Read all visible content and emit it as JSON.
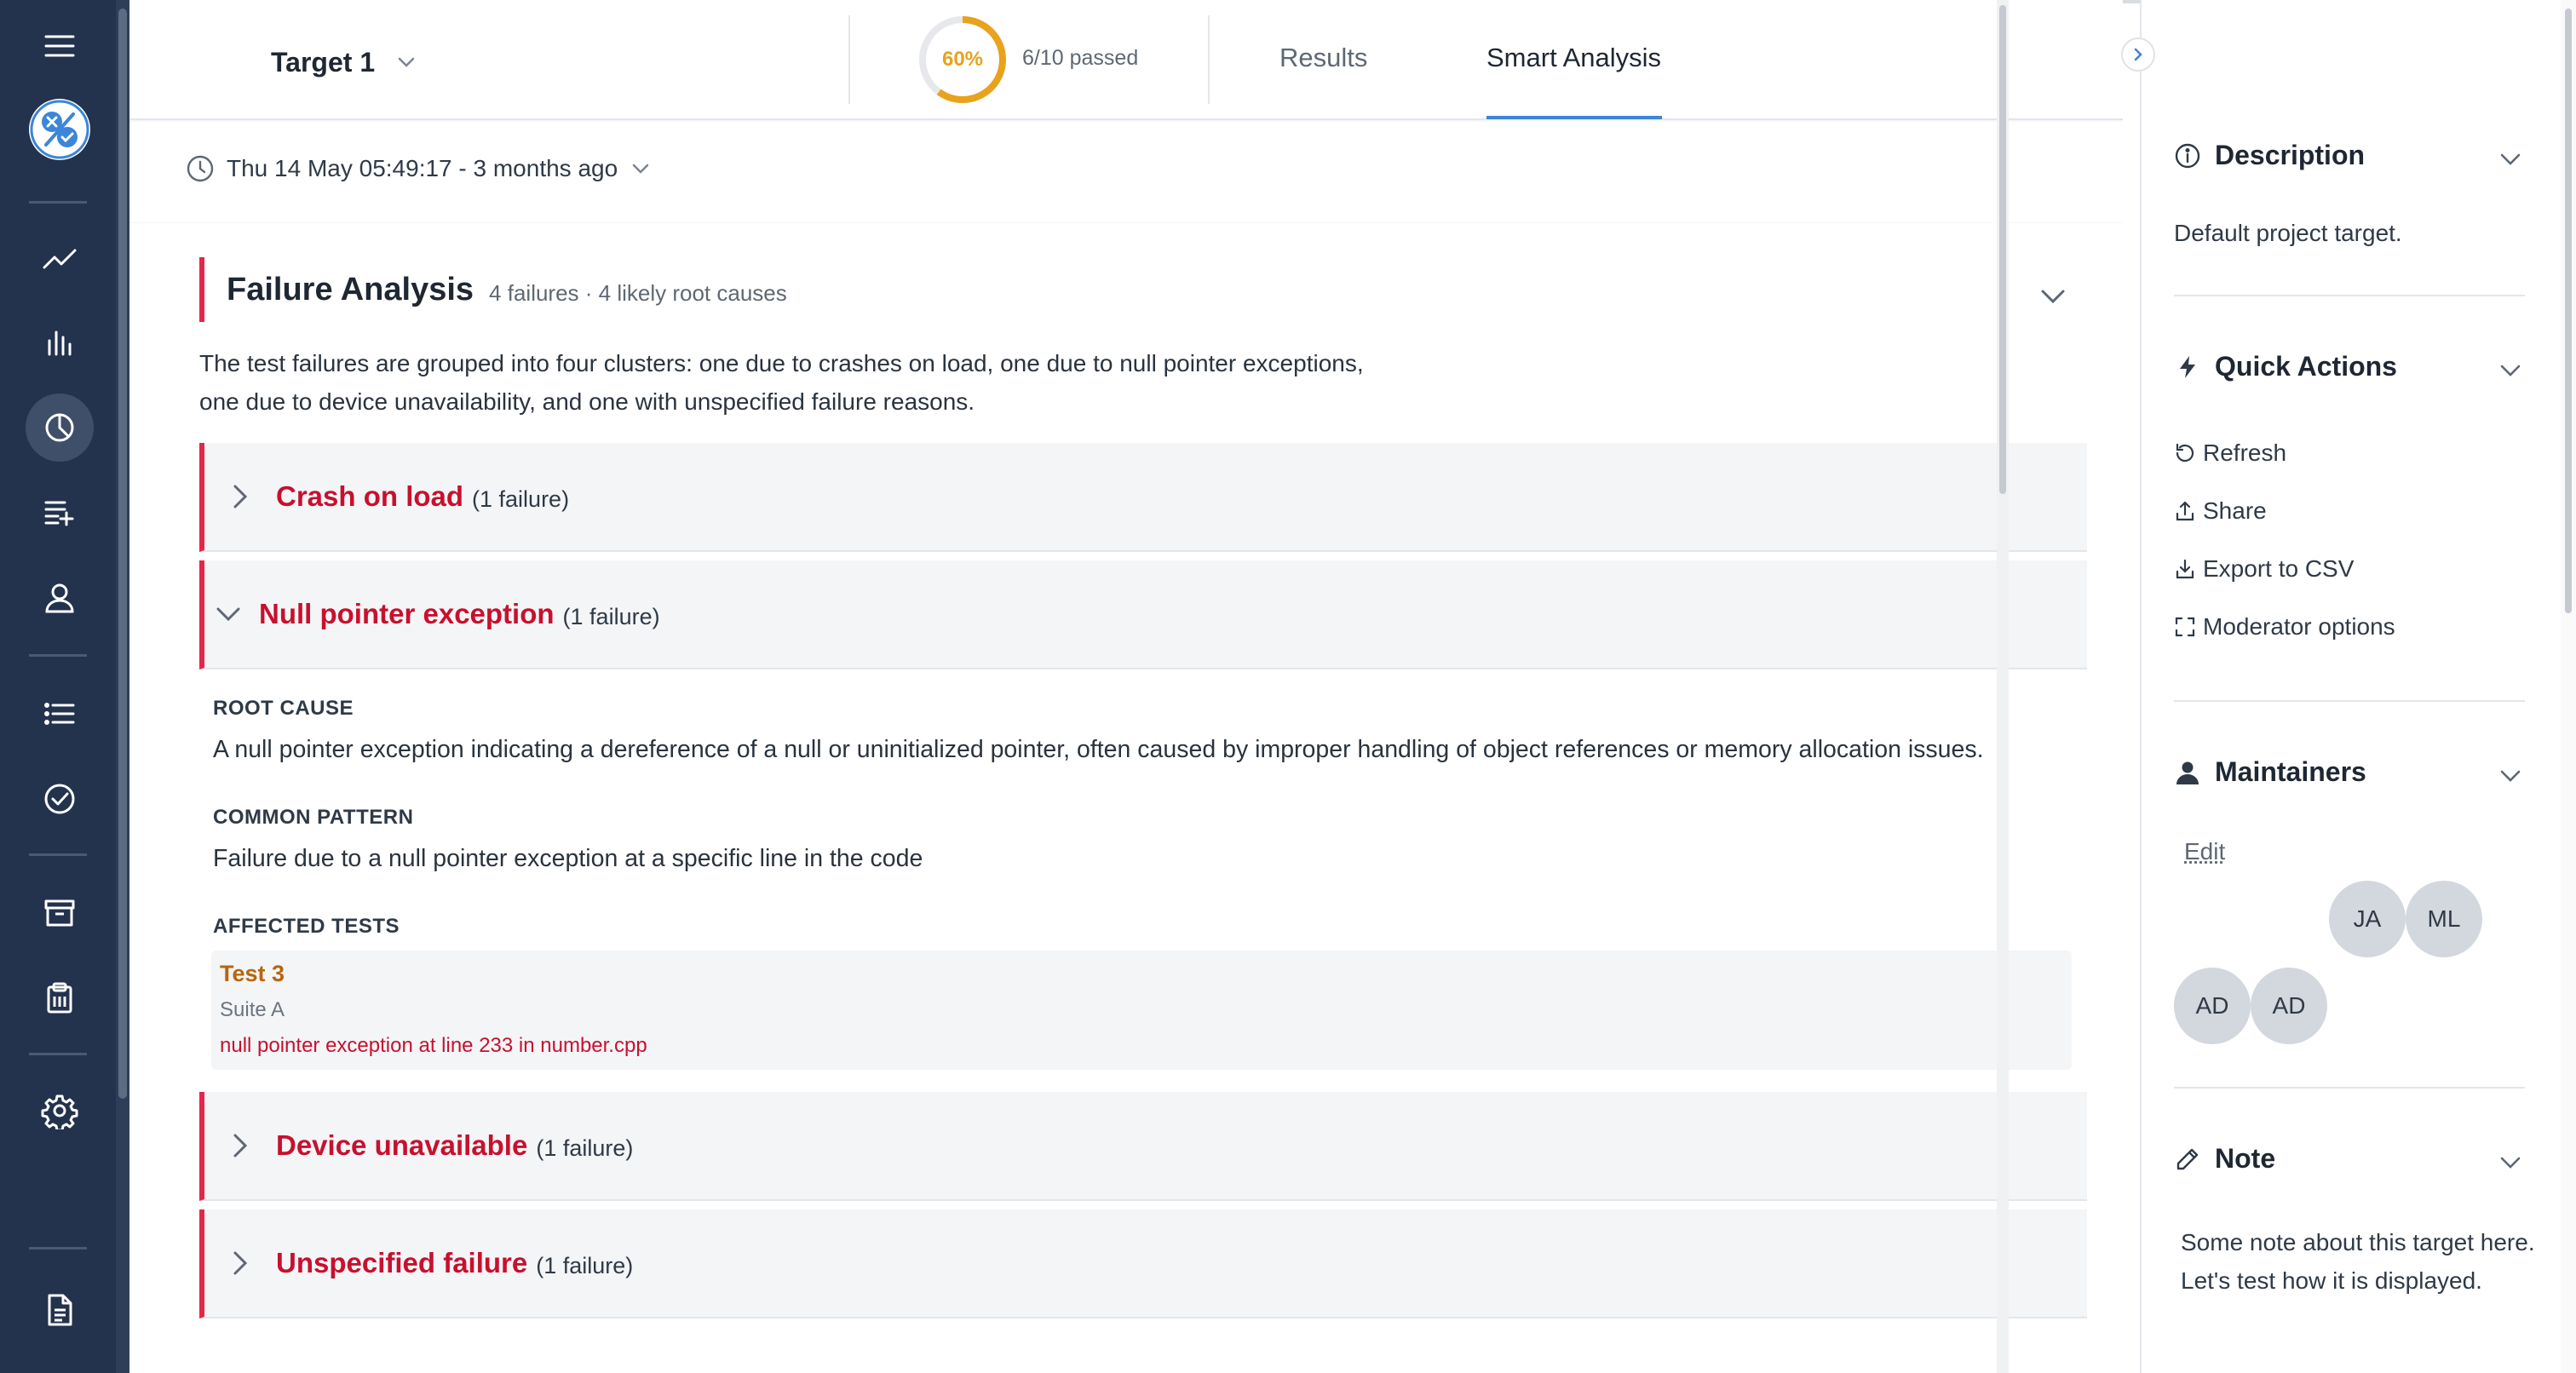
{
  "header": {
    "target_label": "Target 1",
    "progress": {
      "percent_label": "60%",
      "fraction": 0.6,
      "passed_label": "6/10 passed",
      "color": "#e8a21c"
    },
    "tabs": [
      {
        "label": "Results",
        "active": false
      },
      {
        "label": "Smart Analysis",
        "active": true
      }
    ],
    "accent": "#3b86d8"
  },
  "datebar": {
    "label": "Thu 14 May 05:49:17 - 3 months ago"
  },
  "failure_analysis": {
    "title": "Failure Analysis",
    "subtitle": "4 failures · 4 likely root causes",
    "description": "The test failures are grouped into four clusters: one due to crashes on load, one due to null pointer exceptions, one due to device unavailability, and one with unspecified failure reasons.",
    "clusters": [
      {
        "name": "Crash on load",
        "count": "(1 failure)",
        "expanded": false
      },
      {
        "name": "Null pointer exception",
        "count": "(1 failure)",
        "expanded": true
      },
      {
        "name": "Device unavailable",
        "count": "(1 failure)",
        "expanded": false
      },
      {
        "name": "Unspecified failure",
        "count": "(1 failure)",
        "expanded": false
      }
    ],
    "expanded_detail": {
      "root_cause_label": "ROOT CAUSE",
      "root_cause": "A null pointer exception indicating a dereference of a null or uninitialized pointer, often caused by improper handling of object references or memory allocation issues.",
      "pattern_label": "COMMON PATTERN",
      "pattern": "Failure due to a null pointer exception at a specific line in the code",
      "affected_label": "AFFECTED TESTS",
      "test": {
        "name": "Test 3",
        "suite": "Suite A",
        "error": "null pointer exception at line 233 in number.cpp"
      }
    },
    "error_color": "#c8102e"
  },
  "right_panel": {
    "description": {
      "title": "Description",
      "text": "Default project target."
    },
    "quick_actions": {
      "title": "Quick Actions",
      "items": [
        {
          "label": "Refresh",
          "icon": "refresh-icon"
        },
        {
          "label": "Share",
          "icon": "share-icon"
        },
        {
          "label": "Export to CSV",
          "icon": "download-icon"
        },
        {
          "label": "Moderator options",
          "icon": "expand-icon"
        }
      ]
    },
    "maintainers": {
      "title": "Maintainers",
      "edit_label": "Edit",
      "avatars": [
        "JA",
        "ML",
        "AD",
        "AD"
      ]
    },
    "note": {
      "title": "Note",
      "text": "Some note about this target here. Let's test how it is displayed."
    }
  },
  "sidebar": {
    "icons": [
      "menu-icon",
      "logo-icon",
      "trend-icon",
      "bar-chart-icon",
      "pie-chart-icon",
      "add-list-icon",
      "user-icon",
      "list-icon",
      "check-circle-icon",
      "archive-icon",
      "clipboard-icon",
      "gear-icon",
      "document-icon"
    ],
    "active": "pie-chart-icon",
    "background": "#23324d"
  }
}
